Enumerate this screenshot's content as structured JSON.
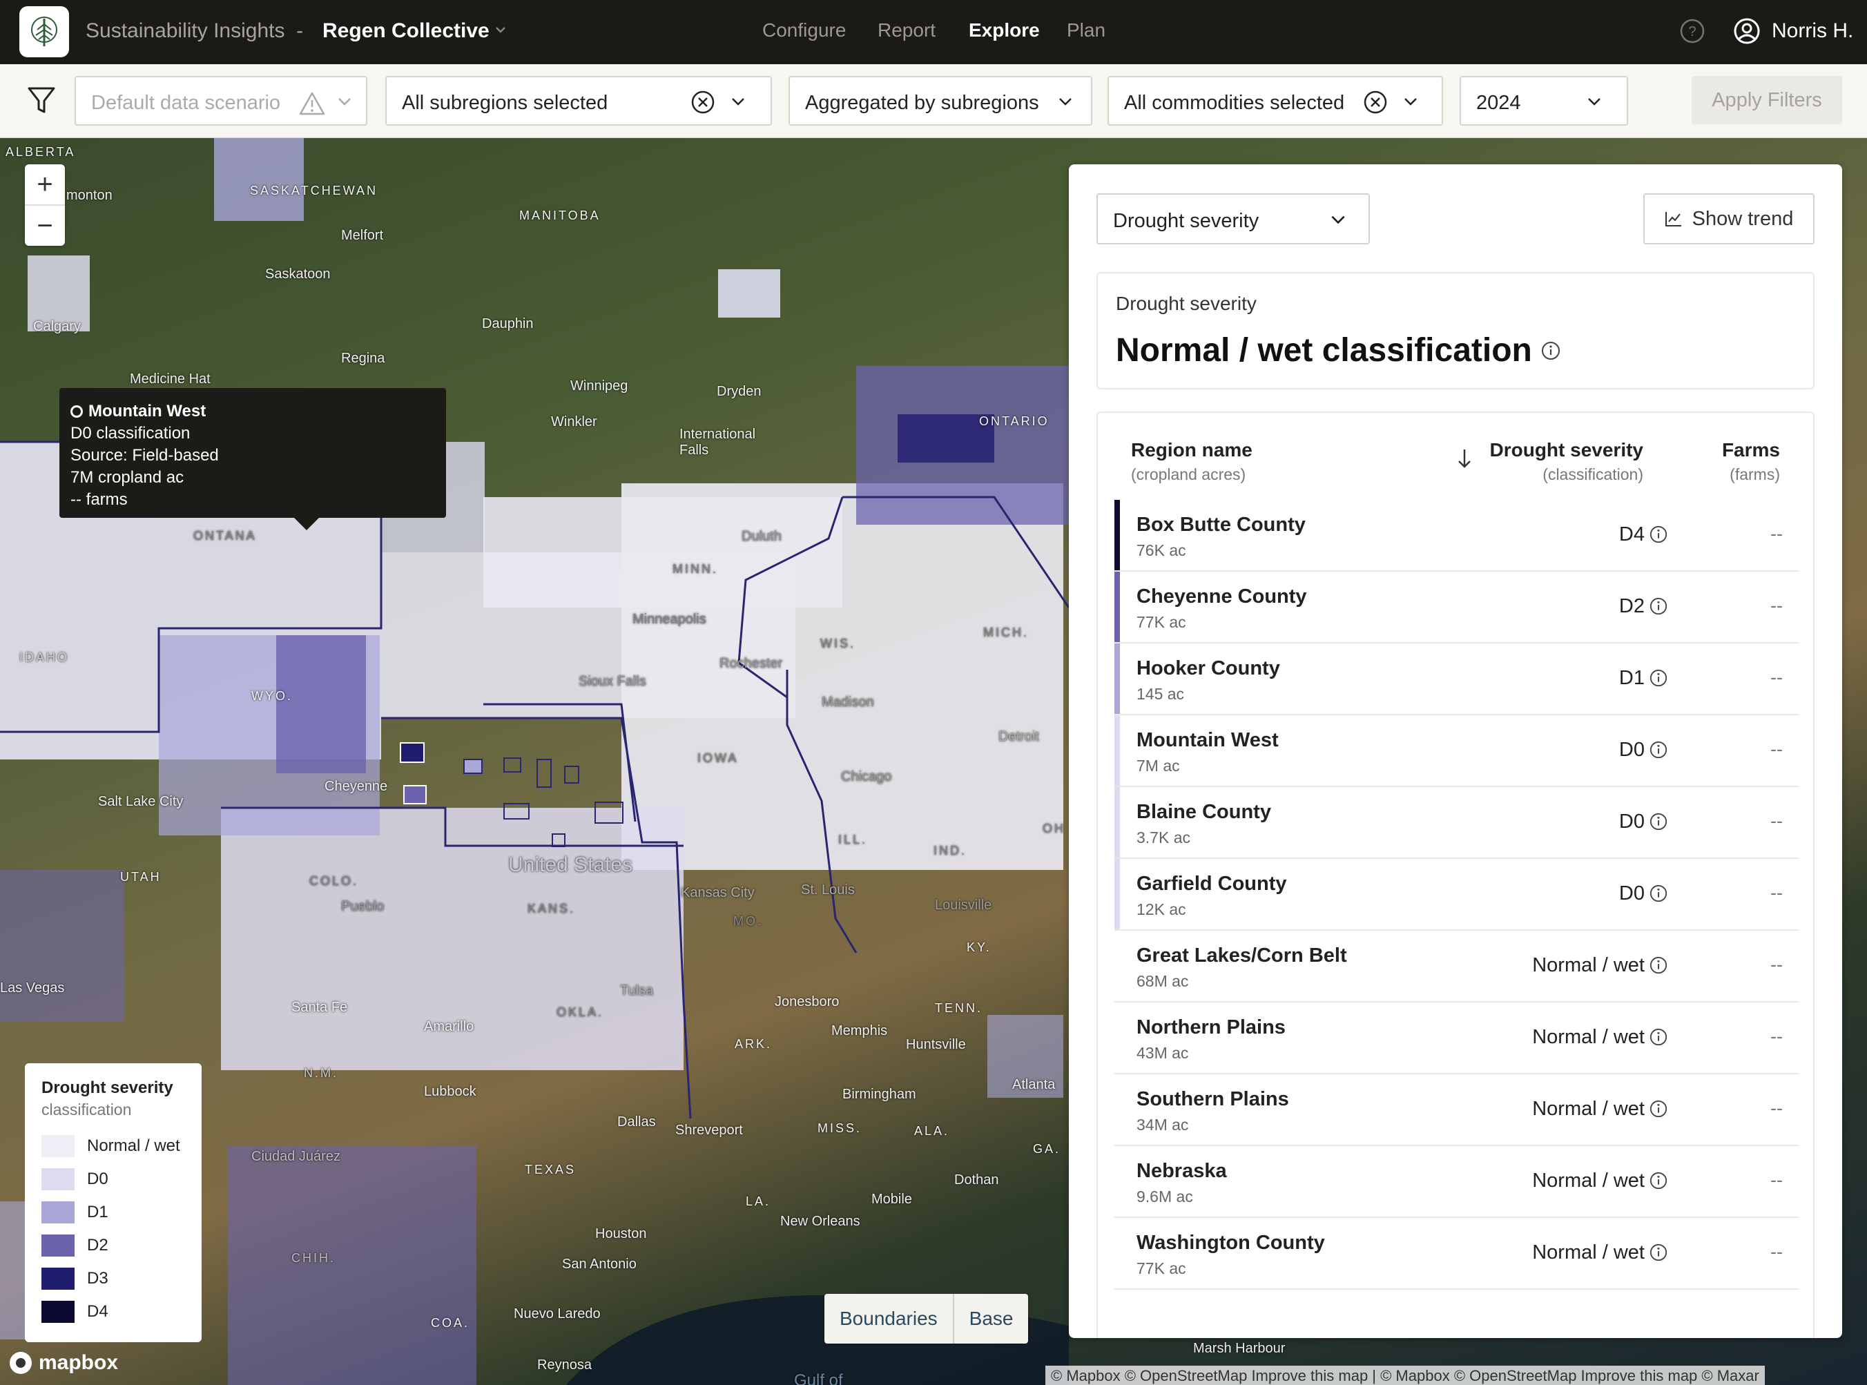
{
  "header": {
    "app_title": "Sustainability Insights",
    "separator": "-",
    "org_name": "Regen Collective",
    "nav": [
      "Configure",
      "Report",
      "Explore",
      "Plan"
    ],
    "active_nav": "Explore",
    "user_name": "Norris H."
  },
  "filters": {
    "scenario_placeholder": "Default data scenario",
    "subregions": "All subregions selected",
    "aggregation": "Aggregated by subregions",
    "commodities": "All commodities selected",
    "year": "2024",
    "apply_label": "Apply Filters"
  },
  "map": {
    "labels": {
      "alberta": "ALBERTA",
      "edmonton": "monton",
      "saskatchewan": "SASKATCHEWAN",
      "manitoba": "MANITOBA",
      "melfort": "Melfort",
      "saskatoon": "Saskatoon",
      "calgary": "Calgary",
      "dauphin": "Dauphin",
      "regina": "Regina",
      "medicine_hat": "Medicine Hat",
      "winnipeg": "Winnipeg",
      "winkler": "Winkler",
      "dryden": "Dryden",
      "intl_falls": "International Falls",
      "ontario": "ONTARIO",
      "montana": "ONTANA",
      "minn": "MINN.",
      "duluth": "Duluth",
      "minneapolis": "Minneapolis",
      "rochester": "Rochester",
      "wis": "WIS.",
      "mich": "MICH.",
      "madison": "Madison",
      "detroit": "Detroit",
      "sioux_falls": "Sioux Falls",
      "idaho": "IDAHO",
      "wyo": "WYO.",
      "cheyenne": "Cheyenne",
      "iowa": "IOWA",
      "chicago": "Chicago",
      "salt_lake": "Salt Lake City",
      "utah": "UTAH",
      "united_states": "United States",
      "ill": "ILL.",
      "ind": "IND.",
      "ohio": "OH",
      "colo": "COLO.",
      "pueblo": "Pueblo",
      "kans": "KANS.",
      "mo": "MO.",
      "st_louis": "St. Louis",
      "kansas_city": "Kansas City",
      "louisville": "Louisville",
      "ky": "KY.",
      "las_vegas": "Las Vegas",
      "tulsa": "Tulsa",
      "okla": "OKLA.",
      "jonesboro": "Jonesboro",
      "tenn": "TENN.",
      "memphis": "Memphis",
      "huntsville": "Huntsville",
      "santa_fe": "Santa Fe",
      "amarillo": "Amarillo",
      "ark": "ARK.",
      "nm": "N.M.",
      "lubbock": "Lubbock",
      "birmingham": "Birmingham",
      "atlanta": "Atlanta",
      "dallas": "Dallas",
      "shreveport": "Shreveport",
      "miss": "MISS.",
      "ala": "ALA.",
      "ga": "GA.",
      "texas": "TEXAS",
      "ciudad_juarez": "Ciudad Juárez",
      "dothan": "Dothan",
      "la": "LA.",
      "mobile": "Mobile",
      "new_orleans": "New Orleans",
      "houston": "Houston",
      "san_antonio": "San Antonio",
      "chih": "CHIH.",
      "coa": "COA.",
      "nuevo_laredo": "Nuevo Laredo",
      "reynosa": "Reynosa",
      "marsh_harbour": "Marsh Harbour",
      "gulf": "Gulf of"
    },
    "tooltip": {
      "title": "Mountain West",
      "lines": [
        "D0 classification",
        "Source: Field-based",
        "7M cropland ac",
        "-- farms"
      ]
    },
    "legend": {
      "title": "Drought severity",
      "subtitle": "classification",
      "items": [
        {
          "label": "Normal / wet",
          "color": "#eeeef6"
        },
        {
          "label": "D0",
          "color": "#dcdbef"
        },
        {
          "label": "D1",
          "color": "#a9a6d8"
        },
        {
          "label": "D2",
          "color": "#6b64ad"
        },
        {
          "label": "D3",
          "color": "#201c6e"
        },
        {
          "label": "D4",
          "color": "#0c0a30"
        }
      ]
    },
    "layer_toggle": [
      "Boundaries",
      "Base"
    ],
    "brand": "mapbox",
    "attribution": "© Mapbox © OpenStreetMap Improve this map | © Mapbox © OpenStreetMap Improve this map © Maxar"
  },
  "panel": {
    "metric_select": "Drought severity",
    "show_trend": "Show trend",
    "summary": {
      "label": "Drought severity",
      "value": "Normal / wet classification"
    },
    "table": {
      "col_region": "Region name",
      "col_region_sub": "(cropland acres)",
      "col_severity": "Drought severity",
      "col_severity_sub": "(classification)",
      "col_farms": "Farms",
      "col_farms_sub": "(farms)",
      "rows": [
        {
          "name": "Box Butte County",
          "acres": "76K ac",
          "severity": "D4",
          "farms": "--",
          "color": "#0c0a30"
        },
        {
          "name": "Cheyenne County",
          "acres": "77K ac",
          "severity": "D2",
          "farms": "--",
          "color": "#6b64ad"
        },
        {
          "name": "Hooker County",
          "acres": "145 ac",
          "severity": "D1",
          "farms": "--",
          "color": "#a9a6d8"
        },
        {
          "name": "Mountain West",
          "acres": "7M ac",
          "severity": "D0",
          "farms": "--",
          "color": "#dcdbef"
        },
        {
          "name": "Blaine County",
          "acres": "3.7K ac",
          "severity": "D0",
          "farms": "--",
          "color": "#dcdbef"
        },
        {
          "name": "Garfield County",
          "acres": "12K ac",
          "severity": "D0",
          "farms": "--",
          "color": "#dcdbef"
        },
        {
          "name": "Great Lakes/Corn Belt",
          "acres": "68M ac",
          "severity": "Normal / wet",
          "farms": "--",
          "color": "#ffffff"
        },
        {
          "name": "Northern Plains",
          "acres": "43M ac",
          "severity": "Normal / wet",
          "farms": "--",
          "color": "#ffffff"
        },
        {
          "name": "Southern Plains",
          "acres": "34M ac",
          "severity": "Normal / wet",
          "farms": "--",
          "color": "#ffffff"
        },
        {
          "name": "Nebraska",
          "acres": "9.6M ac",
          "severity": "Normal / wet",
          "farms": "--",
          "color": "#ffffff"
        },
        {
          "name": "Washington County",
          "acres": "77K ac",
          "severity": "Normal / wet",
          "farms": "--",
          "color": "#ffffff"
        }
      ]
    }
  }
}
